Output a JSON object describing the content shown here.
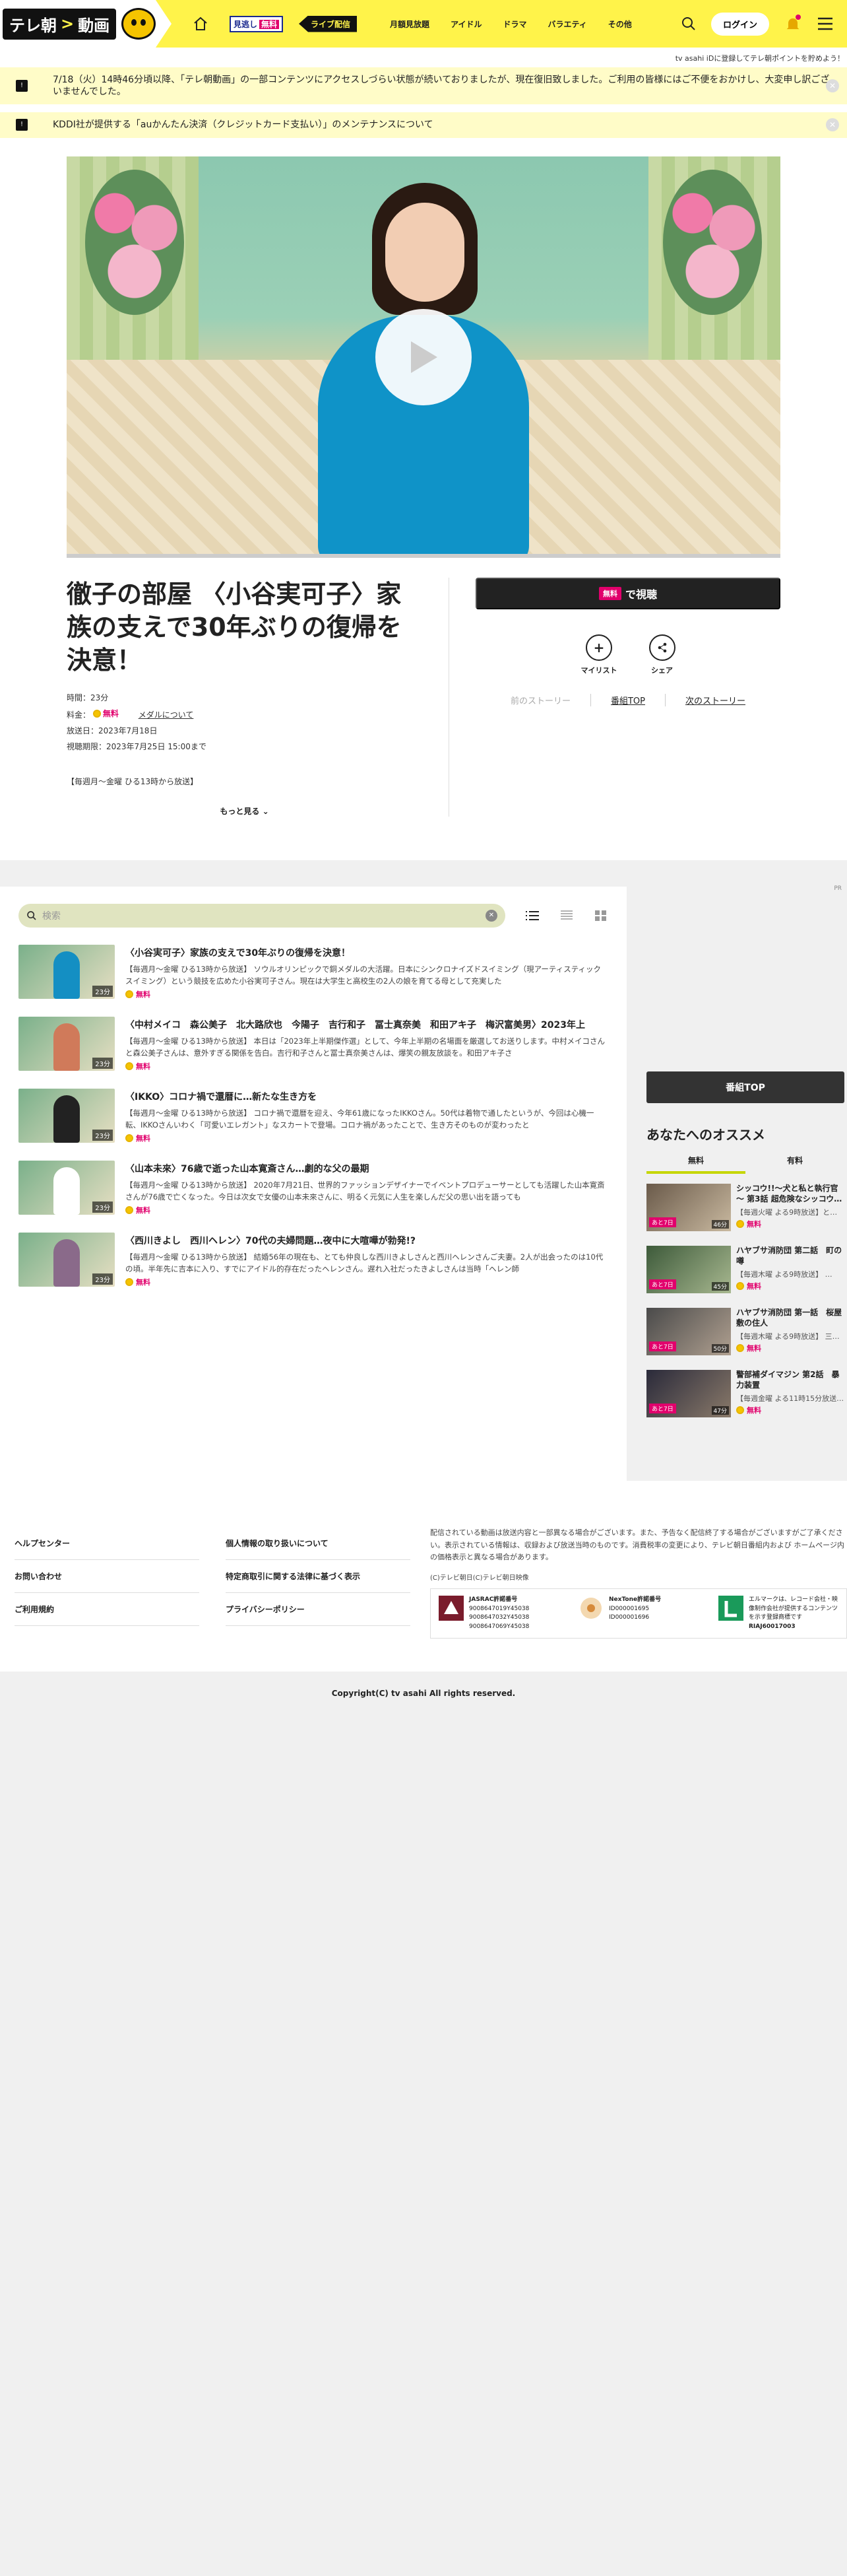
{
  "header": {
    "logo_text": "テレ朝",
    "logo_sub": "動画",
    "mitai": "見逃し",
    "mitai_free": "無料",
    "live": "ライブ配信",
    "nav": [
      "月額見放題",
      "アイドル",
      "ドラマ",
      "バラエティ",
      "その他"
    ],
    "login": "ログイン"
  },
  "subnote": "tv asahi iDに登録してテレ朝ポイントを貯めよう！",
  "notices": [
    "7/18（火）14時46分頃以降、「テレ朝動画」の一部コンテンツにアクセスしづらい状態が続いておりましたが、現在復旧致しました。ご利用の皆様にはご不便をおかけし、大変申し訳ございませんでした。",
    "KDDI社が提供する「auかんたん決済（クレジットカード支払い）」のメンテナンスについて"
  ],
  "program": {
    "title": "徹子の部屋 〈小谷実可子〉家族の支えで30年ぶりの復帰を決意！",
    "duration": "時間：23分",
    "price_label": "料金：",
    "price_free": "無料",
    "media_link": "メダルについて",
    "air_date": "放送日：2023年7月18日",
    "deadline": "視聴期限：2023年7月25日 15:00まで",
    "schedule": "【毎週月～金曜 ひる13時から放送】",
    "more": "もっと見る"
  },
  "watch": {
    "free": "無料",
    "label": "で視聴"
  },
  "actions": {
    "mylist": "マイリスト",
    "share": "シェア"
  },
  "stories": {
    "prev": "前のストーリー",
    "top": "番組TOP",
    "next": "次のストーリー"
  },
  "search": {
    "placeholder": "検索"
  },
  "episodes": [
    {
      "title": "〈小谷実可子〉家族の支えで30年ぶりの復帰を決意！",
      "desc": "【毎週月～金曜 ひる13時から放送】 ソウルオリンピックで銅メダルの大活躍。日本にシンクロナイズドスイミング（現アーティスティックスイミング）という競技を広めた小谷実可子さん。現在は大学生と高校生の2人の娘を育てる母として充実した",
      "duration": "23分",
      "free": "無料"
    },
    {
      "title": "〈中村メイコ　森公美子　北大路欣也　今陽子　吉行和子　冨士真奈美　和田アキ子　梅沢富美男〉2023年上",
      "desc": "【毎週月～金曜 ひる13時から放送】 本日は「2023年上半期傑作選」として、今年上半期の名場面を厳選してお送りします。中村メイコさんと森公美子さんは、意外すぎる関係を告白。吉行和子さんと冨士真奈美さんは、爆笑の親友放談を。和田アキ子さ",
      "duration": "23分",
      "free": "無料"
    },
    {
      "title": "〈IKKO〉コロナ禍で還暦に…新たな生き方を",
      "desc": "【毎週月～金曜 ひる13時から放送】 コロナ禍で還暦を迎え、今年61歳になったIKKOさん。50代は着物で通したというが、今回は心機一転、IKKOさんいわく「可愛いエレガント」なスカートで登場。コロナ禍があったことで、生き方そのものが変わったと",
      "duration": "23分",
      "free": "無料"
    },
    {
      "title": "〈山本未來〉76歳で逝った山本寛斎さん…劇的な父の最期",
      "desc": "【毎週月～金曜 ひる13時から放送】 2020年7月21日、世界的ファッションデザイナーでイベントプロデューサーとしても活躍した山本寛斎さんが76歳で亡くなった。今日は次女で女優の山本未來さんに、明るく元気に人生を楽しんだ父の思い出を語っても",
      "duration": "23分",
      "free": "無料"
    },
    {
      "title": "〈西川きよし　西川ヘレン〉70代の夫婦問題…夜中に大喧嘩が勃発!?",
      "desc": "【毎週月～金曜 ひる13時から放送】 結婚56年の現在も、とても仲良しな西川きよしさんと西川ヘレンさんご夫妻。2人が出会ったのは10代の頃。半年先に吉本に入り、すでにアイドル的存在だったヘレンさん。遅れ入社だったきよしさんは当時「ヘレン師",
      "duration": "23分",
      "free": "無料"
    }
  ],
  "ad_label": "PR",
  "sidebar": {
    "top": "番組TOP",
    "rec_title": "あなたへのオススメ",
    "tabs": [
      "無料",
      "有料"
    ],
    "items": [
      {
        "title": "シッコウ!!～犬と私と執行官～ 第3話 超危険なシッコウ…",
        "sub": "【毎週火曜 よる9時放送】と…",
        "tag": "あと7日",
        "duration": "46分",
        "free": "無料"
      },
      {
        "title": "ハヤブサ消防団 第二話　町の噂",
        "sub": "【毎週木曜 よる9時放送】 …",
        "tag": "あと7日",
        "duration": "45分",
        "free": "無料"
      },
      {
        "title": "ハヤブサ消防団 第一話　桜屋敷の住人",
        "sub": "【毎週木曜 よる9時放送】 三…",
        "tag": "あと7日",
        "duration": "50分",
        "free": "無料"
      },
      {
        "title": "警部補ダイマジン 第2話　暴力装置",
        "sub": "【毎週金曜 よる11時15分放送…",
        "tag": "あと7日",
        "duration": "47分",
        "free": "無料"
      }
    ]
  },
  "footer": {
    "col1": [
      "ヘルプセンター",
      "お問い合わせ",
      "ご利用規約"
    ],
    "col2": [
      "個人情報の取り扱いについて",
      "特定商取引に関する法律に基づく表示",
      "プライバシーポリシー"
    ],
    "note": "配信されている動画は放送内容と一部異なる場合がございます。また、予告なく配信終了する場合がございますがご了承ください。表示されている情報は、収録および放送当時のものです。消費税率の変更により、テレビ朝日番組内および ホームページ内の価格表示と異なる場合があります。",
    "copy_small": "(C)テレビ朝日(C)テレビ朝日映像",
    "lic1": {
      "name": "JASRAC許諾番号",
      "nums": "9008647019Y45038\n9008647032Y45038\n9008647069Y45038"
    },
    "lic2": {
      "name": "NexTone許諾番号",
      "nums": "ID000001695\nID000001696"
    },
    "lic3": {
      "name": "エルマーク",
      "text": "エルマークは、レコード会社・映像制作会社が提供するコンテンツを示す登録商標です",
      "num": "RIAJ60017003"
    },
    "copyright": "Copyright(C) tv asahi All rights reserved."
  }
}
